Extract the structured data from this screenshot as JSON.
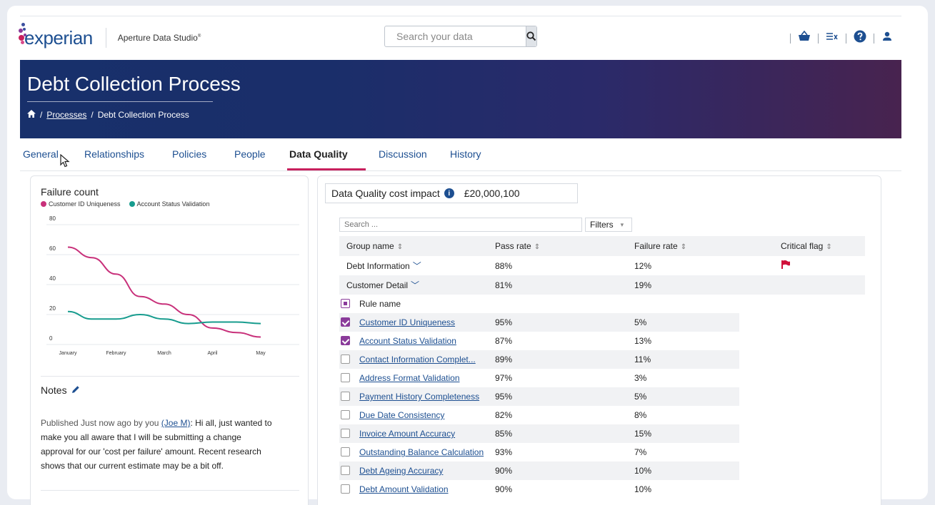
{
  "header": {
    "logo_text": "experian",
    "app_title": "Aperture Data Studio",
    "app_title_mark": "®",
    "search_placeholder": "Search your data"
  },
  "icons": {
    "search": "search-icon",
    "basket": "basket-icon",
    "tasks": "tasks-icon",
    "help": "help-icon",
    "user": "user-icon",
    "home": "home-icon",
    "edit": "pencil-icon",
    "flag": "flag-icon",
    "info": "info-icon"
  },
  "colors": {
    "brand_blue": "#1d4f91",
    "accent_pink": "#c8205d",
    "series_pink": "#c8307a",
    "series_teal": "#179c8e",
    "checkbox_purple": "#8a3b9a",
    "flag_red": "#d0103a"
  },
  "banner": {
    "title": "Debt Collection Process",
    "breadcrumb_link": "Processes",
    "breadcrumb_sep": "/",
    "breadcrumb_current": "Debt Collection Process"
  },
  "tabs": [
    {
      "label": "General"
    },
    {
      "label": "Relationships"
    },
    {
      "label": "Policies"
    },
    {
      "label": "People"
    },
    {
      "label": "Data Quality"
    },
    {
      "label": "Discussion"
    },
    {
      "label": "History"
    }
  ],
  "chart_data": {
    "type": "line",
    "title": "Failure count",
    "categories": [
      "January",
      "February",
      "March",
      "April",
      "May"
    ],
    "x": [
      0,
      1,
      2,
      3,
      4
    ],
    "series": [
      {
        "name": "Customer ID Uniqueness",
        "color": "#c8307a",
        "x": [
          0,
          0.5,
          1,
          1.5,
          2,
          2.5,
          3,
          3.5,
          4
        ],
        "values": [
          65,
          58,
          47,
          32,
          27,
          20,
          11,
          8,
          5
        ]
      },
      {
        "name": "Account Status Validation",
        "color": "#179c8e",
        "x": [
          0,
          0.5,
          1,
          1.5,
          2,
          2.5,
          3,
          3.5,
          4
        ],
        "values": [
          22,
          17,
          17,
          20,
          17,
          14,
          15,
          15,
          14
        ]
      }
    ],
    "yticks": [
      0,
      20,
      40,
      60,
      80
    ],
    "ylim": [
      0,
      80
    ],
    "grid": true,
    "legend": "top-left"
  },
  "notes": {
    "title": "Notes",
    "prefix": "Published Just now ago by you ",
    "author": "(Joe M)",
    "body": ": Hi all, just wanted to make you all aware that I will be submitting a change approval for our 'cost per failure' amount. Recent research shows that our current estimate may be a bit off."
  },
  "dq": {
    "cost_label": "Data Quality cost impact",
    "cost_value": "£20,000,100",
    "search_placeholder": "Search ...",
    "filters_label": "Filters",
    "columns": [
      "Group name",
      "Pass rate",
      "Failure rate",
      "Critical flag"
    ],
    "groups": [
      {
        "name": "Debt Information",
        "pass": "88%",
        "fail": "12%",
        "critical": true
      },
      {
        "name": "Customer Detail",
        "pass": "81%",
        "fail": "19%",
        "critical": false
      }
    ],
    "rule_header": "Rule name",
    "rules": [
      {
        "name": "Customer ID Uniqueness",
        "pass": "95%",
        "fail": "5%",
        "checked": true
      },
      {
        "name": "Account Status Validation",
        "pass": "87%",
        "fail": "13%",
        "checked": true
      },
      {
        "name": "Contact Information Complet...",
        "pass": "89%",
        "fail": "11%",
        "checked": false
      },
      {
        "name": "Address Format Validation",
        "pass": "97%",
        "fail": "3%",
        "checked": false
      },
      {
        "name": "Payment History Completeness",
        "pass": "95%",
        "fail": "5%",
        "checked": false
      },
      {
        "name": "Due Date Consistency",
        "pass": "82%",
        "fail": "8%",
        "checked": false
      },
      {
        "name": "Invoice Amount Accuracy",
        "pass": "85%",
        "fail": "15%",
        "checked": false
      },
      {
        "name": "Outstanding Balance Calculation",
        "pass": "93%",
        "fail": "7%",
        "checked": false
      },
      {
        "name": "Debt Ageing Accuracy",
        "pass": "90%",
        "fail": "10%",
        "checked": false
      },
      {
        "name": "Debt Amount Validation",
        "pass": "90%",
        "fail": "10%",
        "checked": false
      }
    ]
  }
}
